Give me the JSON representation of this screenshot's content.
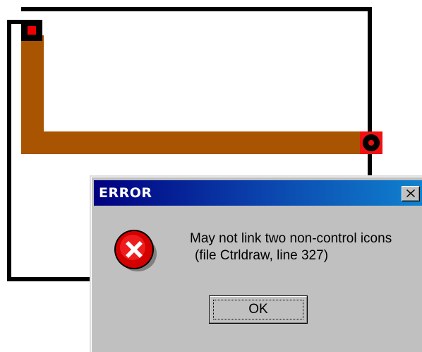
{
  "canvas": {
    "wire_color": "#000000",
    "pipe_color": "#a85400",
    "node_color": "#ee1111"
  },
  "dialog": {
    "title": "ERROR",
    "close_icon": "close-x-icon",
    "message_icon": "error-circle-x-icon",
    "message_line1": "May not link two non-control icons",
    "message_line2": "(file Ctrldraw, line 327)",
    "ok_label": "OK",
    "titlebar_color_start": "#000080",
    "titlebar_color_end": "#1084d0",
    "face_color": "#c0c0c0"
  }
}
